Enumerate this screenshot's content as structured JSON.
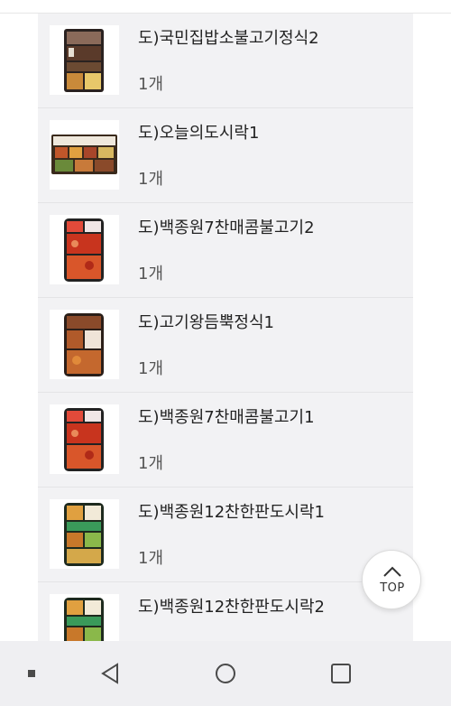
{
  "items": [
    {
      "name": "도)국민집밥소불고기정식2",
      "qty": "1개",
      "icon": "lunchbox-bulgogi-image"
    },
    {
      "name": "도)오늘의도시락1",
      "qty": "1개",
      "icon": "lunchbox-multi-image"
    },
    {
      "name": "도)백종원7찬매콤불고기2",
      "qty": "1개",
      "icon": "lunchbox-spicy-image"
    },
    {
      "name": "도)고기왕듬뿍정식1",
      "qty": "1개",
      "icon": "lunchbox-meat-image"
    },
    {
      "name": "도)백종원7찬매콤불고기1",
      "qty": "1개",
      "icon": "lunchbox-spicy-image"
    },
    {
      "name": "도)백종원12찬한판도시락1",
      "qty": "1개",
      "icon": "lunchbox-green-image"
    },
    {
      "name": "도)백종원12찬한판도시락2",
      "qty": "1개",
      "icon": "lunchbox-green-image"
    }
  ],
  "top_button": {
    "label": "TOP",
    "icon": "chevron-up-icon"
  },
  "navbar": {
    "recent_icon": "dot-icon",
    "back_icon": "back-triangle-icon",
    "home_icon": "home-circle-icon",
    "overview_icon": "square-icon"
  },
  "colors": {
    "panel": "#f2f2f4",
    "navbar": "#efeff2",
    "text": "#222222"
  }
}
